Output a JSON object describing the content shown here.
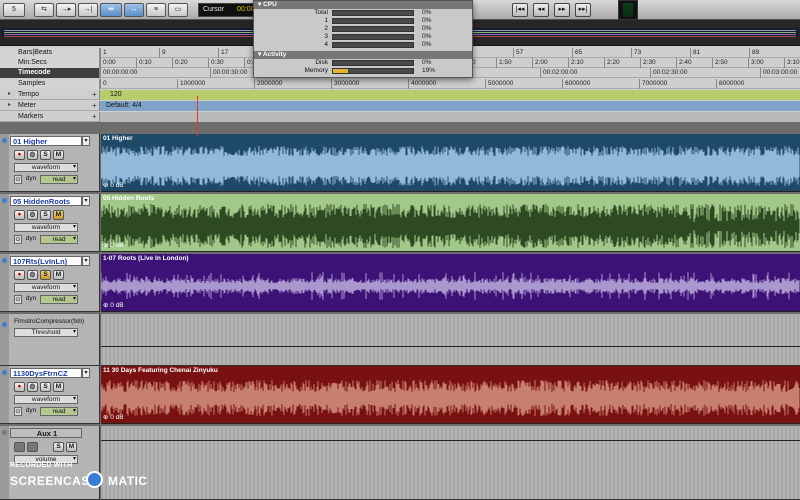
{
  "toolbar": {
    "counter": "5",
    "cursor_label": "Cursor",
    "cursor_value": "00:00"
  },
  "system_usage": {
    "cpu_header": "CPU",
    "cpu_rows": [
      {
        "label": "Total",
        "pct": "0%",
        "level": 0
      },
      {
        "label": "1",
        "pct": "0%",
        "level": 0
      },
      {
        "label": "2",
        "pct": "0%",
        "level": 0
      },
      {
        "label": "3",
        "pct": "0%",
        "level": 0
      },
      {
        "label": "4",
        "pct": "0%",
        "level": 0
      }
    ],
    "activity_header": "Activity",
    "activity_rows": [
      {
        "label": "Disk",
        "pct": "0%",
        "level": 0
      },
      {
        "label": "Memory",
        "pct": "19%",
        "level": 0.19
      }
    ]
  },
  "rulers": {
    "bars_beats": {
      "label": "Bars|Beats",
      "ticks": [
        "1",
        "9",
        "17",
        "25",
        "33",
        "41",
        "49",
        "57",
        "65",
        "73",
        "81",
        "89"
      ]
    },
    "min_secs": {
      "label": "Min:Secs",
      "ticks": [
        "0:00",
        "0:10",
        "0:20",
        "0:30",
        "0:40",
        "0:50",
        "1:00",
        "1:10",
        "1:20",
        "1:30",
        "1:40",
        "1:50",
        "2:00",
        "2:10",
        "2:20",
        "2:30",
        "2:40",
        "2:50",
        "3:00",
        "3:10"
      ]
    },
    "timecode": {
      "label": "Timecode",
      "ticks": [
        "00:00:00:00",
        "00:00:30:00",
        "00:01:00:00",
        "00:01:30:00",
        "00:02:00:00",
        "00:02:30:00",
        "00:03:00:00"
      ]
    },
    "samples": {
      "label": "Samples",
      "ticks": [
        "0",
        "1000000",
        "2000000",
        "3000000",
        "4000000",
        "5000000",
        "6000000",
        "7000000",
        "8000000"
      ]
    },
    "tempo": {
      "label": "Tempo",
      "value": "120"
    },
    "meter": {
      "label": "Meter",
      "value": "Default: 4/4"
    },
    "markers": {
      "label": "Markers"
    }
  },
  "tracks": [
    {
      "name": "01 Higher",
      "clip": "01 Higher",
      "view": "waveform",
      "auto_a": "dyn",
      "auto_b": "read",
      "db": "0 dB",
      "color": "#1e4a67",
      "wave": "#9fc6e6"
    },
    {
      "name": "05 HiddenRoots",
      "clip": "05 Hidden Roots",
      "view": "waveform",
      "auto_a": "dyn",
      "auto_b": "read",
      "db": "0 dB",
      "color": "#a2c98a",
      "wave": "#213d18"
    },
    {
      "name": "107Rts(LvInLn)",
      "clip": "1-07 Roots (Live In London)",
      "view": "waveform",
      "auto_a": "dyn",
      "auto_b": "read",
      "db": "0 dB",
      "color": "#3c1276",
      "wave": "#b6a6d8"
    },
    {
      "plugin": "FlmstroCompressor(fxb)",
      "param": "Threshold"
    },
    {
      "name": "1130DysFtrnCZ",
      "clip": "11 30 Days Featuring Chenai Zinyuku",
      "view": "waveform",
      "auto_a": "dyn",
      "auto_b": "read",
      "db": "0 dB",
      "color": "#7a1111",
      "wave": "#d08d7a"
    },
    {
      "name": "Aux 1",
      "view": "volume"
    }
  ],
  "buttons": {
    "rec": "●",
    "solo": "S",
    "mute": "M",
    "dropdown": "▾"
  },
  "watermark": {
    "line1": "RECORDED WITH",
    "left": "SCREENCAST",
    "right": "MATIC"
  }
}
